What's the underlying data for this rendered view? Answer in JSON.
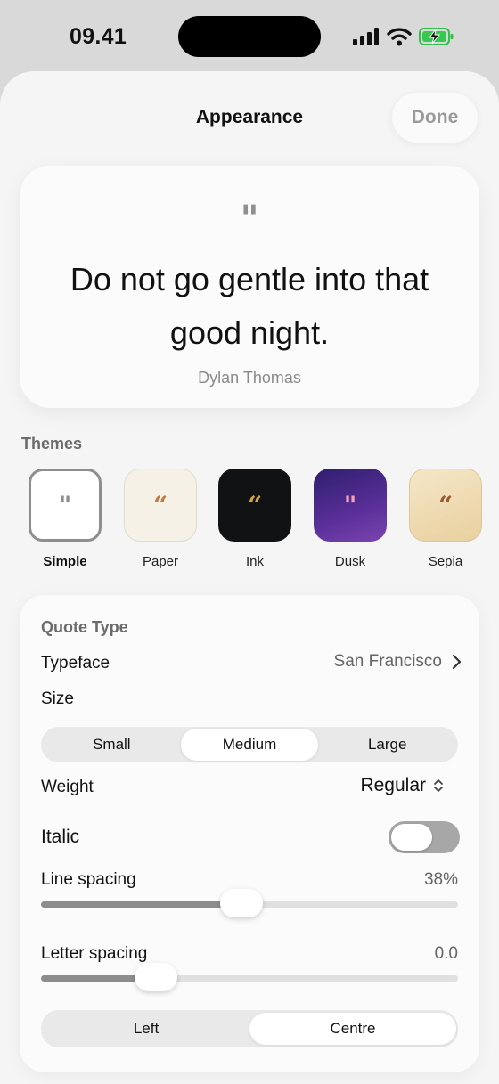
{
  "status_bar": {
    "time": "09.41",
    "icons": [
      "signal-icon",
      "wifi-icon",
      "battery-charging-icon"
    ]
  },
  "header": {
    "title": "Appearance",
    "done_label": "Done"
  },
  "preview": {
    "mark": "\"",
    "quote": "Do not go gentle into that good night.",
    "author": "Dylan Thomas"
  },
  "themes": {
    "title": "Themes",
    "items": [
      {
        "label": "Simple",
        "mark": "\"",
        "bg": "#ffffff",
        "mark_color": "#8e8e8e",
        "selected": true
      },
      {
        "label": "Paper",
        "mark": "“",
        "bg": "#f6f1e7",
        "mark_color": "#c07a45",
        "selected": false
      },
      {
        "label": "Ink",
        "mark": "“",
        "bg": "#101214",
        "mark_color": "#d4a53a",
        "selected": false
      },
      {
        "label": "Dusk",
        "mark": "\"",
        "bg": "#4a2a86",
        "mark_color": "#f4a3b2",
        "selected": false
      },
      {
        "label": "Sepia",
        "mark": "“",
        "bg": "#ecd9b3",
        "mark_color": "#9c5a2e",
        "selected": false
      }
    ]
  },
  "settings": {
    "section_title": "Quote Type",
    "typeface": {
      "label": "Typeface",
      "value": "San Francisco"
    },
    "size": {
      "label": "Size",
      "options": [
        "Small",
        "Medium",
        "Large"
      ],
      "selected": "Medium"
    },
    "weight": {
      "label": "Weight",
      "value": "Regular"
    },
    "italic": {
      "label": "Italic",
      "on": false
    },
    "line_spacing": {
      "label": "Line spacing",
      "value": "38%",
      "fraction": 0.48
    },
    "letter_spacing": {
      "label": "Letter spacing",
      "value": "0.0",
      "fraction": 0.276
    },
    "alignment": {
      "options": [
        "Left",
        "Centre"
      ],
      "selected": "Centre"
    }
  },
  "colors": {
    "sheet_bg": "#f5f5f5",
    "card_bg": "#fbfbfb",
    "accent_gray": "#8d8d8d"
  }
}
